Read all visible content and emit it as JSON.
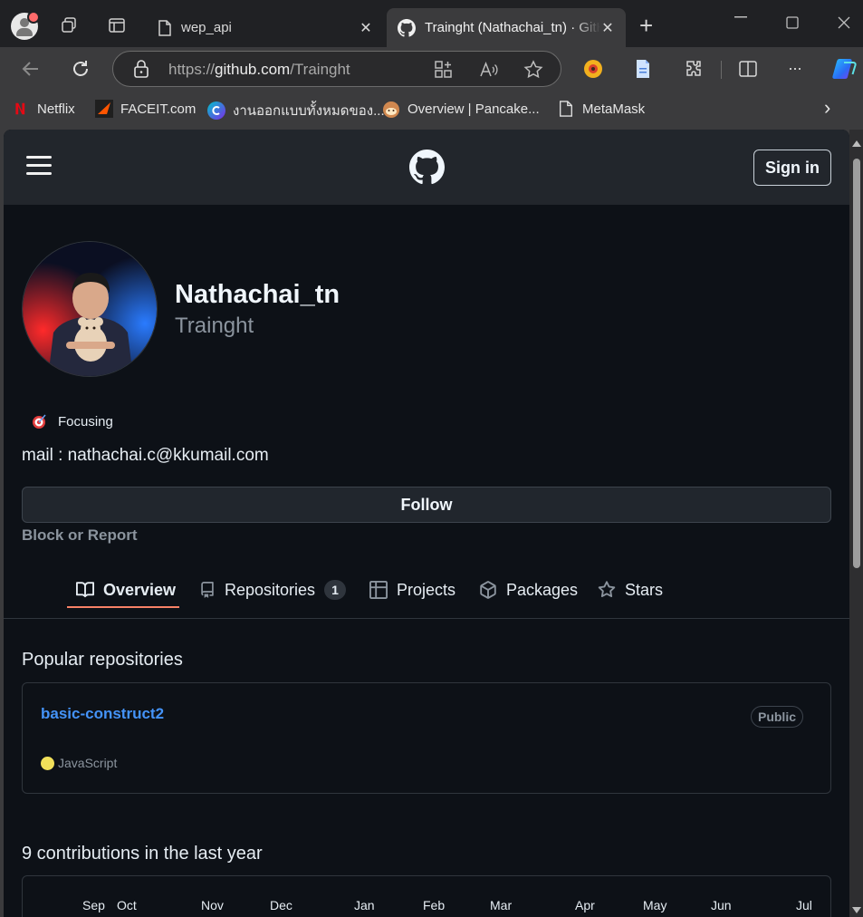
{
  "browser": {
    "tabs": [
      {
        "title": "wep_api",
        "close": "✕"
      },
      {
        "title": "Trainght (Nathachai_tn) · GitHub",
        "close": "✕"
      }
    ],
    "new_tab": "+",
    "address": {
      "prefix": "https://",
      "host": "github.com",
      "path": "/Trainght"
    },
    "bookmarks": [
      "Netflix",
      "FACEIT.com",
      "งานออกแบบทั้งหมดของ...",
      "Overview | Pancake...",
      "MetaMask"
    ],
    "more": "›",
    "menu": "···"
  },
  "github": {
    "sign_in": "Sign in",
    "profile": {
      "name": "Nathachai_tn",
      "login": "Trainght",
      "status": "Focusing",
      "bio": "mail : nathachai.c@kkumail.com",
      "follow": "Follow",
      "block": "Block or Report"
    },
    "tabs": [
      {
        "label": "Overview",
        "icon": "book-icon"
      },
      {
        "label": "Repositories",
        "icon": "repo-icon",
        "count": "1"
      },
      {
        "label": "Projects",
        "icon": "table-icon"
      },
      {
        "label": "Packages",
        "icon": "package-icon"
      },
      {
        "label": "Stars",
        "icon": "star-icon"
      }
    ],
    "popular_title": "Popular repositories",
    "repo": {
      "name": "basic-construct2",
      "visibility": "Public",
      "language": "JavaScript",
      "language_color": "#f1e05a"
    },
    "contrib_title": "9 contributions in the last year",
    "months": [
      "Sep",
      "Oct",
      "Nov",
      "Dec",
      "Jan",
      "Feb",
      "Mar",
      "Apr",
      "May",
      "Jun",
      "Jul"
    ]
  },
  "colors": {
    "accent_link": "#4493f8",
    "tab_underline": "#f78166",
    "page_bg": "#0d1117"
  }
}
